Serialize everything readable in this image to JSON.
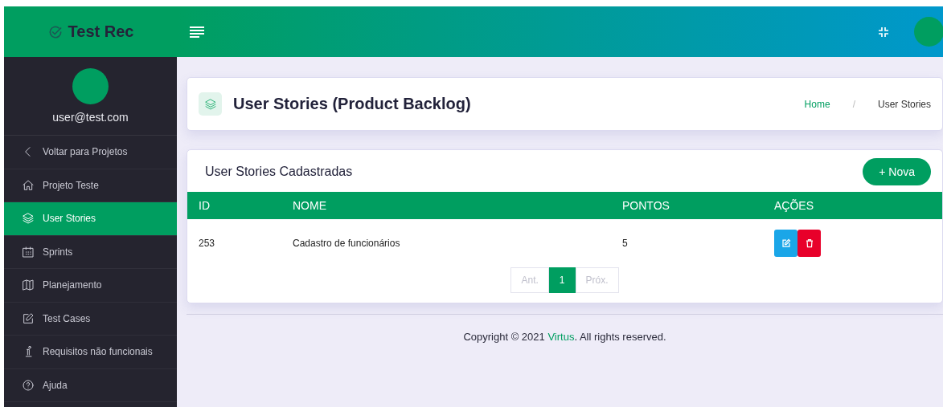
{
  "brand": {
    "name": "Test Rec"
  },
  "user": {
    "email": "user@test.com"
  },
  "sidebar": {
    "items": [
      {
        "label": "Voltar para Projetos",
        "selected": false
      },
      {
        "label": "Projeto Teste",
        "selected": false
      },
      {
        "label": "User Stories",
        "selected": true
      },
      {
        "label": "Sprints",
        "selected": false
      },
      {
        "label": "Planejamento",
        "selected": false
      },
      {
        "label": "Test Cases",
        "selected": false
      },
      {
        "label": "Requisitos não funcionais",
        "selected": false
      },
      {
        "label": "Ajuda",
        "selected": false
      }
    ]
  },
  "page_header": {
    "title": "User Stories (Product Backlog)",
    "breadcrumb": [
      {
        "label": "Home",
        "link": true
      },
      {
        "label": "/",
        "link": false
      },
      {
        "label": "User Stories",
        "link": false
      }
    ]
  },
  "card": {
    "title": "User Stories Cadastradas",
    "new_button": "+ Nova",
    "table": {
      "columns": [
        "ID",
        "NOME",
        "PONTOS",
        "AÇÕES"
      ],
      "rows": [
        {
          "id": "253",
          "name": "Cadastro de funcionários",
          "points": "5"
        }
      ]
    },
    "pagination": [
      {
        "label": "Ant.",
        "selected": false
      },
      {
        "label": "1",
        "selected": true
      },
      {
        "label": "Próx.",
        "selected": false
      }
    ]
  },
  "footer": {
    "before": "Copyright © 2021 ",
    "link": "Virtus",
    "after": ". All rights reserved."
  }
}
